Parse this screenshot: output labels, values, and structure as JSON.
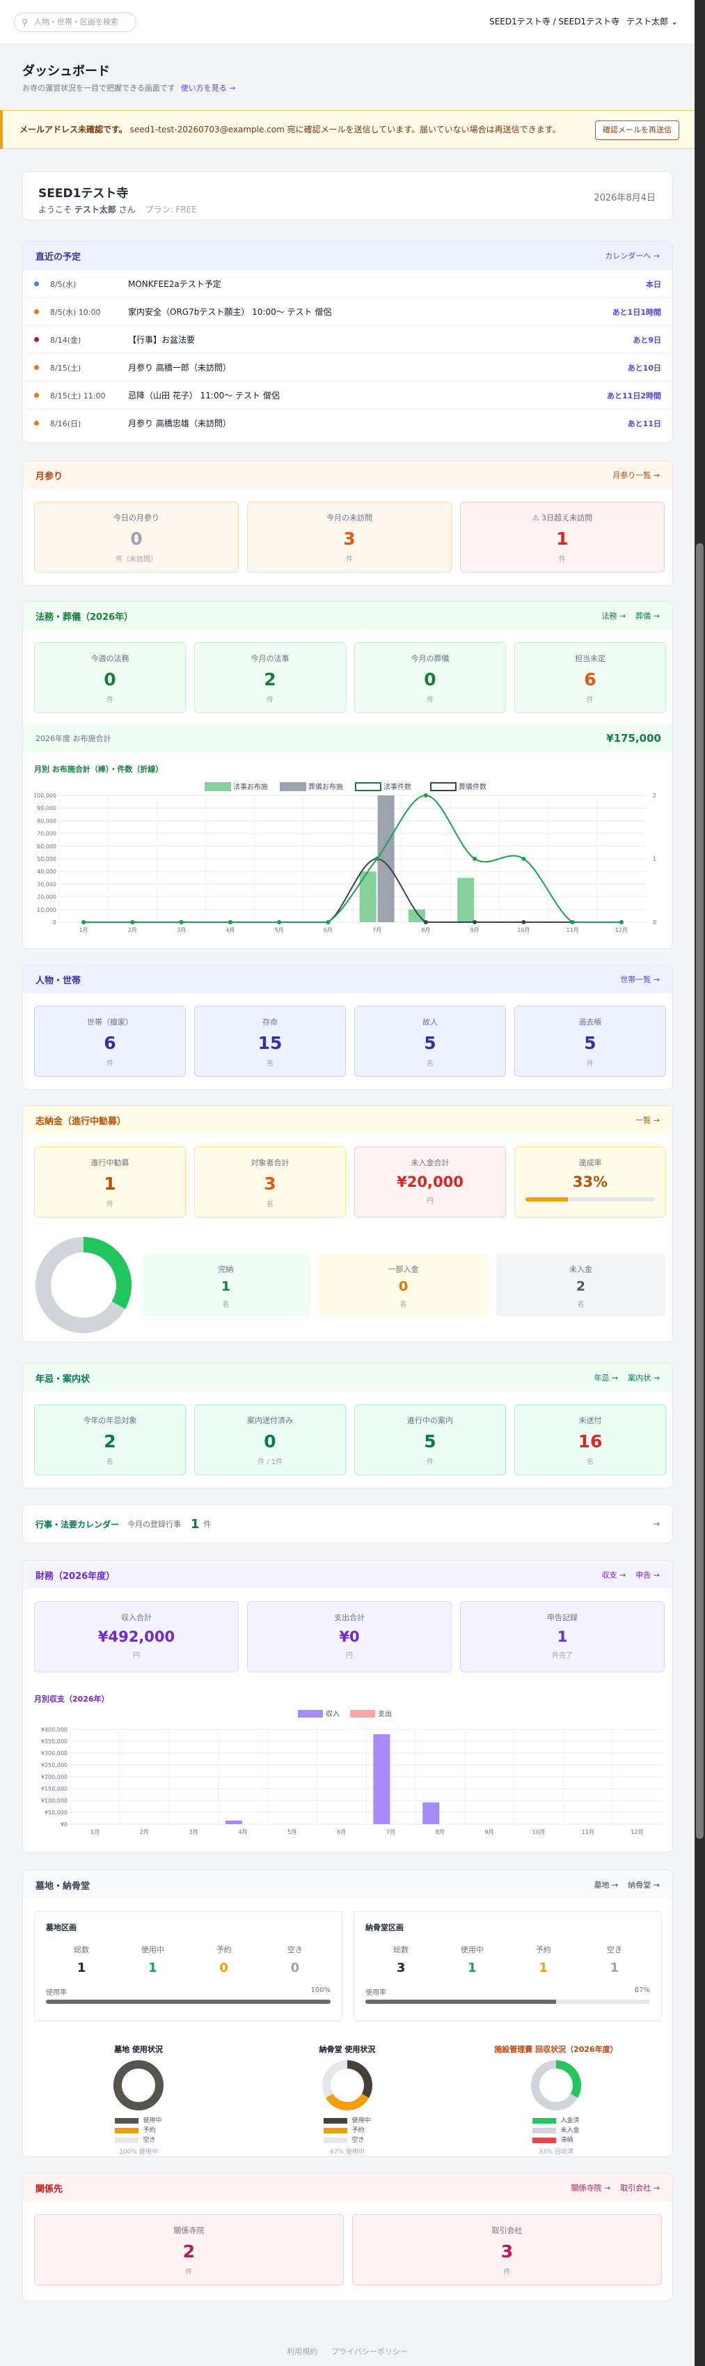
{
  "topbar": {
    "search_placeholder": "人物・世帯・区画を検索",
    "org": "SEED1テスト寺 / SEED1テスト寺",
    "user": "テスト太郎"
  },
  "header": {
    "title": "ダッシュボード",
    "subtitle": "お寺の運営状況を一目で把握できる画面です",
    "help_link": "使い方を見る →"
  },
  "alert": {
    "strong": "メールアドレス未確認です。",
    "text": "seed1-test-20260703@example.com 宛に確認メールを送信しています。届いていない場合は再送信できます。",
    "button": "確認メールを再送信"
  },
  "welcome": {
    "title": "SEED1テスト寺",
    "greeting_prefix": "ようこそ",
    "user": "テスト太郎",
    "greeting_suffix": "さん",
    "plan": "プラン: FREE",
    "date": "2026年8月4日"
  },
  "upcoming": {
    "title": "直近の予定",
    "link": "カレンダーへ →",
    "items": [
      {
        "date": "8/5(水)",
        "title": "MONKFEE2aテスト予定",
        "rel": "本日",
        "color": "#3b82f6"
      },
      {
        "date": "8/5(水) 10:00",
        "title": "家内安全（ORG7bテスト願主） 10:00〜 テスト 僧侶",
        "rel": "あと1日1時間",
        "color": "#f97316"
      },
      {
        "date": "8/14(金)",
        "title": "【行事】お盆法要",
        "rel": "あと9日",
        "color": "#b91c1c"
      },
      {
        "date": "8/15(土)",
        "title": "月参り 高橋一郎（未訪問）",
        "rel": "あと10日",
        "color": "#f97316"
      },
      {
        "date": "8/15(土) 11:00",
        "title": "忌降（山田 花子） 11:00〜 テスト 僧侶",
        "rel": "あと11日2時間",
        "color": "#f97316"
      },
      {
        "date": "8/16(日)",
        "title": "月参り 高橋忠雄（未訪問）",
        "rel": "あと11日",
        "color": "#f97316"
      }
    ]
  },
  "monthly": {
    "title": "月参り",
    "link": "月参り一覧 →",
    "stats": [
      {
        "label": "今日の月参り",
        "value": "0",
        "unit": "件（未訪問）"
      },
      {
        "label": "今月の未訪問",
        "value": "3",
        "unit": "件"
      },
      {
        "label": "⚠ 3日超え未訪問",
        "value": "1",
        "unit": "件"
      }
    ]
  },
  "hoji": {
    "title": "法務・葬儀（2026年）",
    "link1": "法務 →",
    "link2": "葬儀 →",
    "stats": [
      {
        "label": "今週の法務",
        "value": "0",
        "unit": "件"
      },
      {
        "label": "今月の法事",
        "value": "2",
        "unit": "件"
      },
      {
        "label": "今月の葬儀",
        "value": "0",
        "unit": "件"
      },
      {
        "label": "担当未定",
        "value": "6",
        "unit": "件"
      }
    ],
    "total_label": "2026年度 お布施合計",
    "total_value": "¥175,000",
    "chart_title": "月別 お布施合計（棒）・件数（折線）"
  },
  "chart_data": [
    {
      "type": "bar",
      "title": "月別 お布施合計（棒）・件数（折線）",
      "categories": [
        "1月",
        "2月",
        "3月",
        "4月",
        "5月",
        "6月",
        "7月",
        "8月",
        "9月",
        "10月",
        "11月",
        "12月"
      ],
      "series": [
        {
          "name": "法事お布施",
          "type": "bar",
          "axis": "left",
          "values": [
            0,
            0,
            0,
            0,
            0,
            0,
            40000,
            10000,
            35000,
            0,
            0,
            0
          ]
        },
        {
          "name": "葬儀お布施",
          "type": "bar",
          "axis": "left",
          "values": [
            0,
            0,
            0,
            0,
            0,
            0,
            100000,
            0,
            0,
            0,
            0,
            0
          ]
        },
        {
          "name": "法事件数",
          "type": "line",
          "axis": "right",
          "values": [
            0,
            0,
            0,
            0,
            0,
            0,
            1,
            2,
            1,
            1,
            0,
            0
          ]
        },
        {
          "name": "葬儀件数",
          "type": "line",
          "axis": "right",
          "values": [
            0,
            0,
            0,
            0,
            0,
            0,
            1,
            0,
            0,
            0,
            0,
            0
          ]
        }
      ],
      "ylim": [
        0,
        100000
      ],
      "y2lim": [
        0,
        2
      ],
      "legend": "top",
      "yticks": [
        "100,000",
        "90,000",
        "80,000",
        "70,000",
        "60,000",
        "50,000",
        "40,000",
        "30,000",
        "20,000",
        "10,000",
        "0"
      ],
      "y2ticks": [
        "2",
        "1",
        "0"
      ]
    },
    {
      "type": "bar",
      "title": "月別収支（2026年）",
      "categories": [
        "1月",
        "2月",
        "3月",
        "4月",
        "5月",
        "6月",
        "7月",
        "8月",
        "9月",
        "10月",
        "11月",
        "12月"
      ],
      "series": [
        {
          "name": "収入",
          "values": [
            0,
            0,
            0,
            15000,
            0,
            0,
            380000,
            92000,
            0,
            0,
            0,
            0
          ]
        },
        {
          "name": "支出",
          "values": [
            0,
            0,
            0,
            0,
            0,
            0,
            0,
            0,
            0,
            0,
            0,
            0
          ]
        }
      ],
      "ylim": [
        0,
        400000
      ],
      "legend": "top",
      "yticks": [
        "¥400,000",
        "¥350,000",
        "¥300,000",
        "¥250,000",
        "¥200,000",
        "¥150,000",
        "¥100,000",
        "¥50,000",
        "¥0"
      ]
    }
  ],
  "people": {
    "title": "人物・世帯",
    "link": "世帯一覧 →",
    "stats": [
      {
        "label": "世帯（檀家）",
        "value": "6",
        "unit": "件"
      },
      {
        "label": "存命",
        "value": "15",
        "unit": "名"
      },
      {
        "label": "故人",
        "value": "5",
        "unit": "名"
      },
      {
        "label": "過去帳",
        "value": "5",
        "unit": "件"
      }
    ]
  },
  "donation": {
    "title": "志納金（進行中勧募）",
    "link": "一覧 →",
    "stats": [
      {
        "label": "進行中勧募",
        "value": "1",
        "unit": "件"
      },
      {
        "label": "対象者合計",
        "value": "3",
        "unit": "名"
      },
      {
        "label": "未入金合計",
        "value": "¥20,000",
        "unit": "円"
      },
      {
        "label": "達成率",
        "value": "33%",
        "unit": ""
      }
    ],
    "progress": 0.33,
    "sub": [
      {
        "label": "完納",
        "value": "1",
        "unit": "名"
      },
      {
        "label": "一部入金",
        "value": "0",
        "unit": "名"
      },
      {
        "label": "未入金",
        "value": "2",
        "unit": "名"
      }
    ],
    "donut": [
      1,
      0,
      2
    ]
  },
  "nenki": {
    "title": "年忌・案内状",
    "link1": "年忌 →",
    "link2": "案内状 →",
    "stats": [
      {
        "label": "今年の年忌対象",
        "value": "2",
        "unit": "名"
      },
      {
        "label": "案内送付済み",
        "value": "0",
        "unit": "件 / 1件"
      },
      {
        "label": "進行中の案内",
        "value": "5",
        "unit": "件"
      },
      {
        "label": "未送付",
        "value": "16",
        "unit": "名"
      }
    ]
  },
  "calendar": {
    "title": "行事・法要カレンダー",
    "sub": "今月の登録行事",
    "value": "1",
    "unit": "件",
    "link": "→"
  },
  "finance": {
    "title": "財務（2026年度）",
    "link1": "収支 →",
    "link2": "申告 →",
    "stats": [
      {
        "label": "収入合計",
        "value": "¥492,000",
        "unit": "円"
      },
      {
        "label": "支出合計",
        "value": "¥0",
        "unit": "円"
      },
      {
        "label": "申告記録",
        "value": "1",
        "unit": "件完了"
      }
    ],
    "chart_title": "月別収支（2026年）"
  },
  "grave": {
    "title": "墓地・納骨堂",
    "link1": "墓地 →",
    "link2": "納骨堂 →",
    "boxes": [
      {
        "title": "墓地区画",
        "cols": [
          {
            "l": "総数",
            "v": "1"
          },
          {
            "l": "使用中",
            "v": "1"
          },
          {
            "l": "予約",
            "v": "0"
          },
          {
            "l": "空き",
            "v": "0"
          }
        ],
        "usage_label": "使用率",
        "usage": "100%",
        "ratio": 1.0
      },
      {
        "title": "納骨堂区画",
        "cols": [
          {
            "l": "総数",
            "v": "3"
          },
          {
            "l": "使用中",
            "v": "1"
          },
          {
            "l": "予約",
            "v": "1"
          },
          {
            "l": "空き",
            "v": "1"
          }
        ],
        "usage_label": "使用率",
        "usage": "67%",
        "ratio": 0.67
      }
    ],
    "donuts": [
      {
        "title": "墓地 使用状況",
        "legend": [
          "使用中",
          "予約",
          "空き"
        ],
        "foot": "100% 使用中",
        "values": [
          1,
          0,
          0
        ],
        "colors": [
          "#57534e",
          "#f59e0b",
          "#e5e7eb"
        ]
      },
      {
        "title": "納骨堂 使用状況",
        "legend": [
          "使用中",
          "予約",
          "空き"
        ],
        "foot": "67% 使用中",
        "values": [
          1,
          1,
          1
        ],
        "colors": [
          "#44403c",
          "#f59e0b",
          "#e5e7eb"
        ]
      },
      {
        "title": "施設管理費 回収状況（2026年度）",
        "legend": [
          "入金済",
          "未入金",
          "滞納"
        ],
        "foot": "33% 回収済",
        "values": [
          1,
          2,
          0
        ],
        "colors": [
          "#22c55e",
          "#d1d5db",
          "#ef4444"
        ]
      }
    ]
  },
  "related": {
    "title": "関係先",
    "link1": "關係寺院 →",
    "link2": "取引会社 →",
    "stats": [
      {
        "label": "關係寺院",
        "value": "2",
        "unit": "件"
      },
      {
        "label": "取引会社",
        "value": "3",
        "unit": "件"
      }
    ]
  },
  "footer": {
    "terms": "利用規約",
    "privacy": "プライバシーポリシー"
  }
}
